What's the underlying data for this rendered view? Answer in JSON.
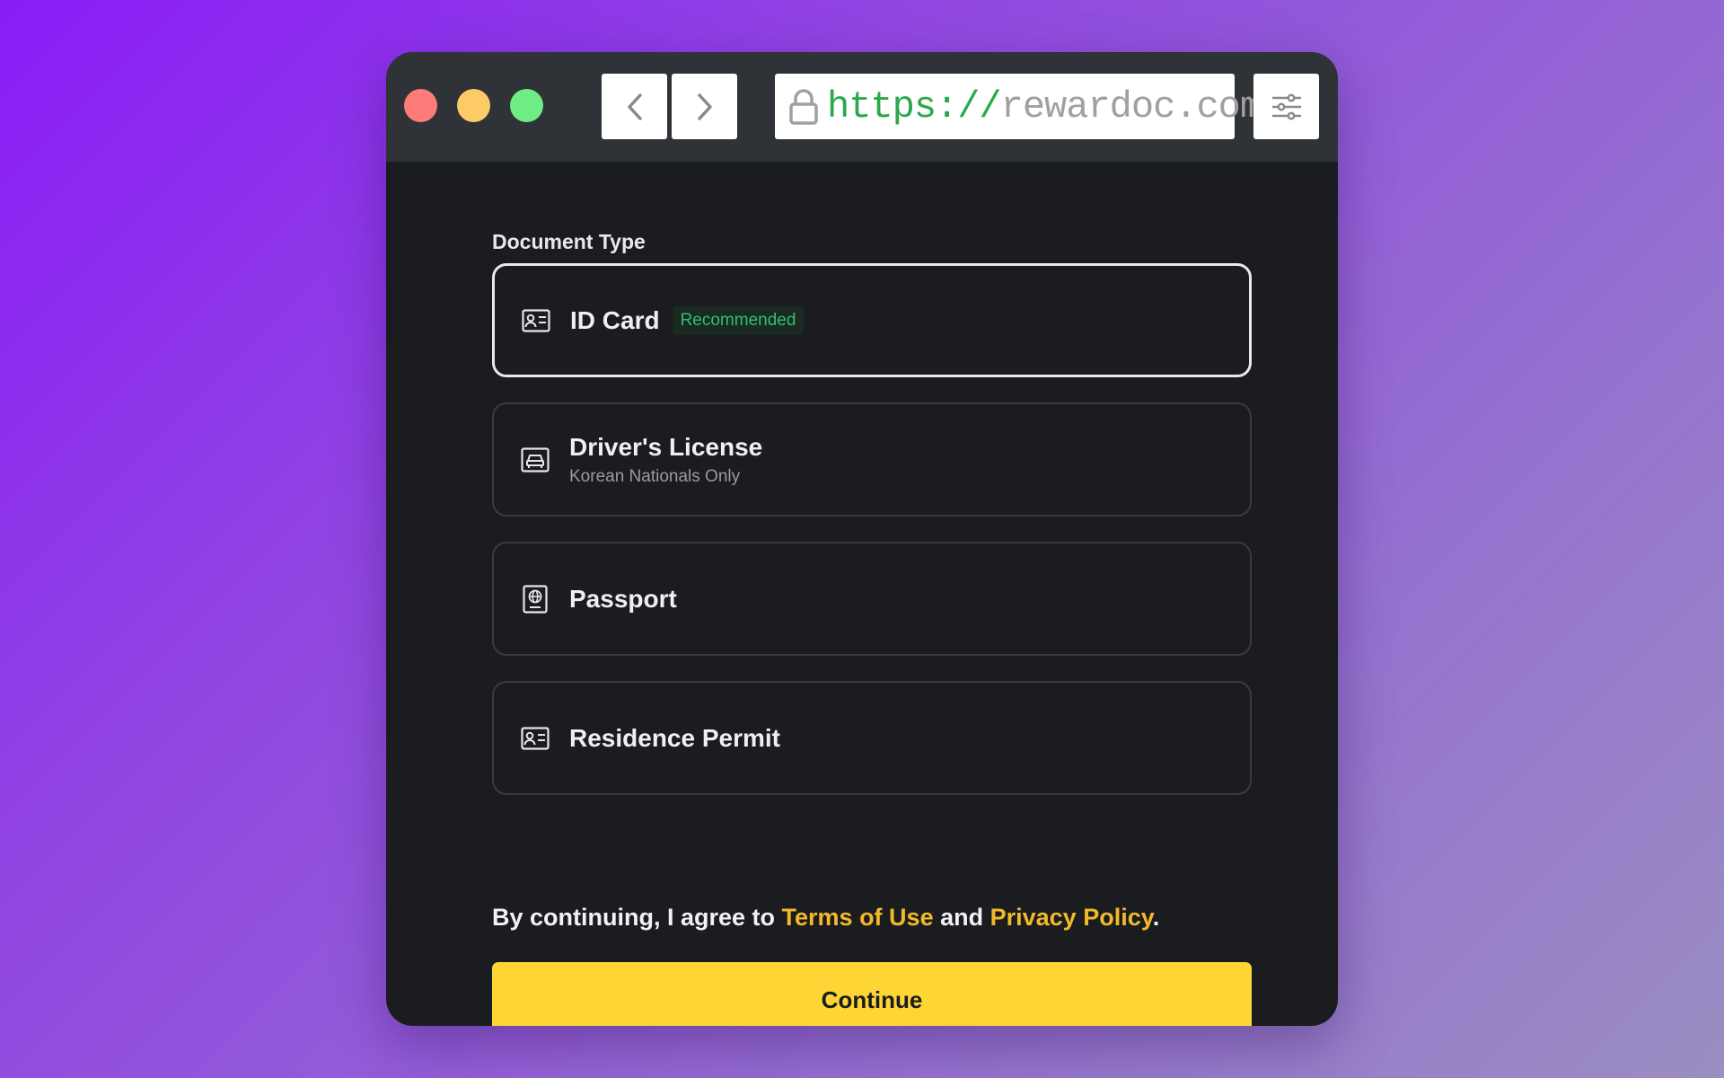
{
  "browser": {
    "url_protocol": "https://",
    "url_host": "rewardoc.com"
  },
  "form": {
    "section_label": "Document Type",
    "options": [
      {
        "label": "ID Card",
        "badge": "Recommended",
        "icon": "id-card-icon",
        "selected": true
      },
      {
        "label": "Driver's License",
        "sublabel": "Korean Nationals Only",
        "icon": "car-icon",
        "selected": false
      },
      {
        "label": "Passport",
        "icon": "passport-icon",
        "selected": false
      },
      {
        "label": "Residence Permit",
        "icon": "id-card-icon",
        "selected": false
      }
    ]
  },
  "consent": {
    "prefix": "By continuing, I agree to ",
    "terms": "Terms of Use",
    "conjunction": " and ",
    "privacy": "Privacy Policy",
    "suffix": "."
  },
  "actions": {
    "continue_label": "Continue"
  },
  "colors": {
    "accent": "#fdd535",
    "link": "#f2b929",
    "badge_text": "#2fbf72",
    "panel_bg": "#1b1c1f",
    "titlebar_bg": "#2f3236"
  }
}
